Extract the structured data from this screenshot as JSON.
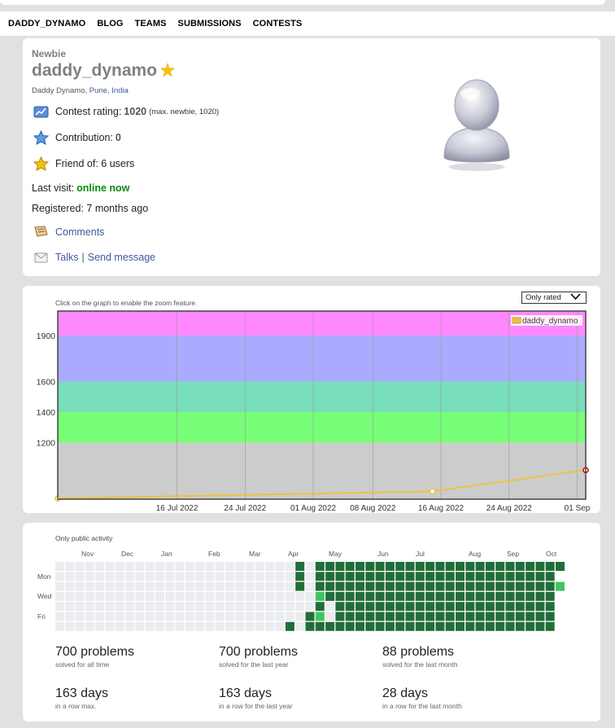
{
  "nav": {
    "items": [
      "DADDY_DYNAMO",
      "BLOG",
      "TEAMS",
      "SUBMISSIONS",
      "CONTESTS"
    ]
  },
  "profile": {
    "rank": "Newbie",
    "handle": "daddy_dynamo",
    "full_name": "Daddy Dynamo,",
    "city": "Pune",
    "comma": ",",
    "country": "India",
    "rating_label": "Contest rating:",
    "rating_value": "1020",
    "rating_max": "(max. newbie, 1020)",
    "contribution_label": "Contribution:",
    "contribution_value": "0",
    "friends_label": "Friend of: 6 users",
    "last_visit_label": "Last visit:",
    "last_visit_value": "online now",
    "registered": "Registered: 7 months ago",
    "comments": "Comments",
    "talks": "Talks",
    "separator": "|",
    "send_message": "Send message"
  },
  "rating_graph": {
    "hint": "Click on the graph to enable the zoom feature.",
    "filter_value": "Only rated",
    "chart_data": {
      "type": "line",
      "series": [
        {
          "name": "daddy_dynamo",
          "color": "#edc240",
          "points": [
            [
              "2022-07-02",
              835
            ],
            [
              "2022-08-15",
              881
            ],
            [
              "2022-09-02",
              1020
            ]
          ]
        }
      ],
      "x_ticks": [
        "16 Jul 2022",
        "24 Jul 2022",
        "01 Aug 2022",
        "08 Aug 2022",
        "16 Aug 2022",
        "24 Aug 2022",
        "01 Sep"
      ],
      "y_ticks": [
        "1200",
        "1400",
        "1600",
        "1900"
      ],
      "xlim": [
        "2022-07-02",
        "2022-09-02"
      ],
      "ylim": [
        830,
        2060
      ],
      "bands": [
        {
          "from": 830,
          "to": 1200,
          "color": "#cccccc"
        },
        {
          "from": 1200,
          "to": 1400,
          "color": "#77ff77"
        },
        {
          "from": 1400,
          "to": 1600,
          "color": "#77ddbb"
        },
        {
          "from": 1600,
          "to": 1900,
          "color": "#aaaaff"
        },
        {
          "from": 1900,
          "to": 2060,
          "color": "#ff88ff"
        }
      ],
      "legend": "top-right"
    }
  },
  "activity": {
    "note": "Only public activity",
    "months": [
      "Nov",
      "Dec",
      "Jan",
      "Feb",
      "Mar",
      "Apr",
      "May",
      "Jun",
      "Jul",
      "Aug",
      "Sep",
      "Oct"
    ],
    "days": [
      "Mon",
      "Wed",
      "Fri"
    ],
    "colors": {
      "empty": "#ebedf0",
      "light": "#40c463",
      "dark": "#216e39"
    },
    "stats": [
      {
        "big": "700 problems",
        "cap": "solved for all time"
      },
      {
        "big": "700 problems",
        "cap": "solved for the last year"
      },
      {
        "big": "88 problems",
        "cap": "solved for the last month"
      },
      {
        "big": "163 days",
        "cap": "in a row max."
      },
      {
        "big": "163 days",
        "cap": "in a row for the last year"
      },
      {
        "big": "28 days",
        "cap": "in a row for the last month"
      }
    ]
  }
}
